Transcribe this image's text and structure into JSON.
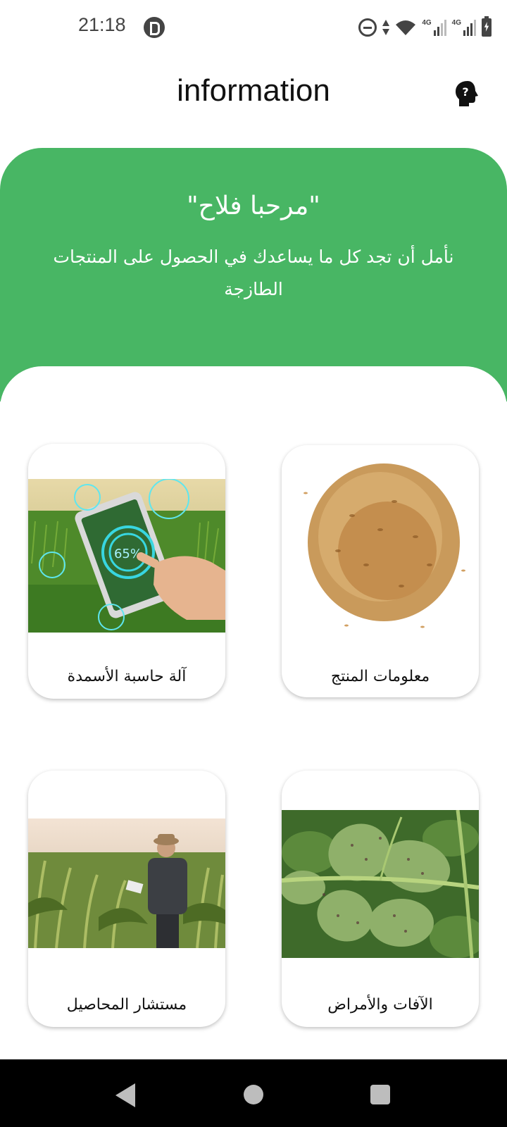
{
  "status_bar": {
    "time": "21:18",
    "network_label_1": "4G",
    "network_label_2": "4G"
  },
  "header": {
    "title": "information",
    "help_icon": "help-head-icon"
  },
  "banner": {
    "title": "\"مرحبا فلاح\"",
    "subtitle": "نأمل أن تجد كل ما يساعدك في الحصول على المنتجات الطازجة",
    "color": "#48b664"
  },
  "cards": {
    "fertilizer_calculator": {
      "label": "آلة حاسبة الأسمدة",
      "image": "smart-farming-tablet-image",
      "tablet_readout": "65%"
    },
    "product_info": {
      "label": "معلومات المنتج",
      "image": "grain-pile-image"
    },
    "crop_advisor": {
      "label": "مستشار المحاصيل",
      "image": "farmer-in-cornfield-image"
    },
    "pests_diseases": {
      "label": "الآفات والأمراض",
      "image": "diseased-leaf-image"
    }
  },
  "navbar": {
    "back_icon": "back-triangle-icon",
    "home_icon": "home-circle-icon",
    "recent_icon": "recent-square-icon"
  }
}
